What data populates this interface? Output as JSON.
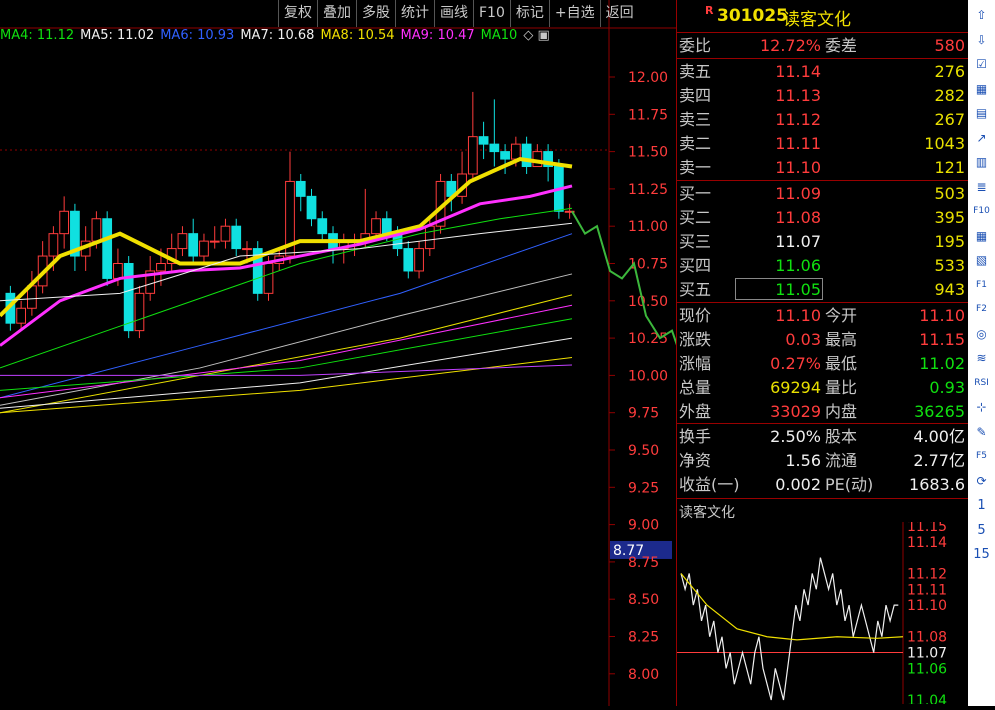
{
  "toolbar": [
    "复权",
    "叠加",
    "多股",
    "统计",
    "画线",
    "F10",
    "标记",
    "+自选",
    "返回"
  ],
  "ma_legend": [
    {
      "label": "MA4: 11.12",
      "color": "#10e010"
    },
    {
      "label": "MA5: 11.02",
      "color": "#f0f0f0"
    },
    {
      "label": "MA6: 10.93",
      "color": "#3060ff"
    },
    {
      "label": "MA7: 10.68",
      "color": "#f0f0f0"
    },
    {
      "label": "MA8: 10.54",
      "color": "#f0e000"
    },
    {
      "label": "MA9: 10.47",
      "color": "#ff30ff"
    },
    {
      "label": "MA10",
      "color": "#10e010"
    }
  ],
  "price_axis": [
    "12.00",
    "11.75",
    "11.50",
    "11.25",
    "11.00",
    "10.75",
    "10.50",
    "10.25",
    "10.00",
    "9.75",
    "9.50",
    "9.25",
    "9.00",
    "8.77",
    "8.75",
    "8.50",
    "8.25",
    "8.00"
  ],
  "current_axis_marker": "8.77",
  "stock": {
    "badge": "R",
    "code": "301025",
    "name": "读客文化"
  },
  "weibi": {
    "label": "委比",
    "value": "12.72%",
    "label2": "委差",
    "value2": "580"
  },
  "sells": [
    {
      "label": "卖五",
      "price": "11.14",
      "vol": "276"
    },
    {
      "label": "卖四",
      "price": "11.13",
      "vol": "282"
    },
    {
      "label": "卖三",
      "price": "11.12",
      "vol": "267"
    },
    {
      "label": "卖二",
      "price": "11.11",
      "vol": "1043"
    },
    {
      "label": "卖一",
      "price": "11.10",
      "vol": "121"
    }
  ],
  "buys": [
    {
      "label": "买一",
      "price": "11.09",
      "vol": "503",
      "color": "red"
    },
    {
      "label": "买二",
      "price": "11.08",
      "vol": "395",
      "color": "red"
    },
    {
      "label": "买三",
      "price": "11.07",
      "vol": "195",
      "color": "white"
    },
    {
      "label": "买四",
      "price": "11.06",
      "vol": "533",
      "color": "green"
    },
    {
      "label": "买五",
      "price": "11.05",
      "vol": "943",
      "color": "green"
    }
  ],
  "stats": [
    {
      "l1": "现价",
      "v1": "11.10",
      "c1": "red",
      "l2": "今开",
      "v2": "11.10",
      "c2": "red"
    },
    {
      "l1": "涨跌",
      "v1": "0.03",
      "c1": "red",
      "l2": "最高",
      "v2": "11.15",
      "c2": "red"
    },
    {
      "l1": "涨幅",
      "v1": "0.27%",
      "c1": "red",
      "l2": "最低",
      "v2": "11.02",
      "c2": "green"
    },
    {
      "l1": "总量",
      "v1": "69294",
      "c1": "yellow",
      "l2": "量比",
      "v2": "0.93",
      "c2": "green"
    },
    {
      "l1": "外盘",
      "v1": "33029",
      "c1": "red",
      "l2": "内盘",
      "v2": "36265",
      "c2": "green"
    }
  ],
  "fund": [
    {
      "l1": "换手",
      "v1": "2.50%",
      "l2": "股本",
      "v2": "4.00亿"
    },
    {
      "l1": "净资",
      "v1": "1.56",
      "l2": "流通",
      "v2": "2.77亿"
    },
    {
      "l1": "收益(一)",
      "v1": "0.002",
      "l2": "PE(动)",
      "v2": "1683.6"
    }
  ],
  "mini": {
    "title": "读客文化",
    "axis": [
      "11.15",
      "11.14",
      "11.12",
      "11.11",
      "11.10",
      "11.08",
      "11.07",
      "11.06",
      "11.04"
    ]
  },
  "rail": [
    "⇧",
    "⇩",
    "☑",
    "▦",
    "▤",
    "↗",
    "▥",
    "≣",
    "F10",
    "▦",
    "▧",
    "F1",
    "F2",
    "◎",
    "≋",
    "RSI",
    "⊹",
    "✎",
    "F5",
    "⟳",
    "1",
    "5",
    "15"
  ],
  "colors": {
    "up": "#ff3c3c",
    "down": "#10e0e0",
    "bg": "#000000",
    "grid": "#900000"
  }
}
